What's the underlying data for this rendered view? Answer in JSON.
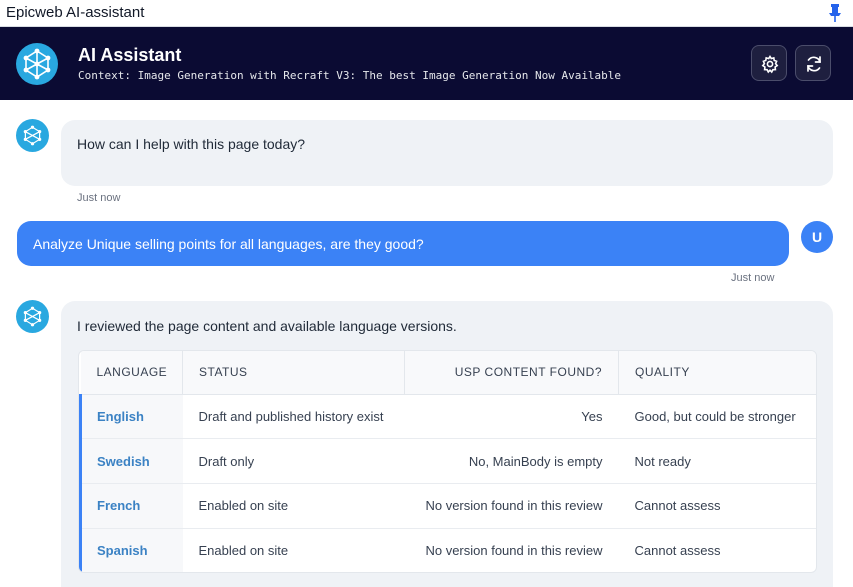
{
  "window": {
    "title": "Epicweb AI-assistant",
    "pin_icon": "pin-icon"
  },
  "header": {
    "title": "AI Assistant",
    "context": "Context: Image Generation with Recraft V3: The best Image Generation Now Available",
    "settings_icon": "gear-icon",
    "refresh_icon": "refresh-icon",
    "background": "#0b0b33"
  },
  "messages": {
    "greeting": {
      "text": "How can I help with this page today?",
      "time": "Just now"
    },
    "user": {
      "avatar": "U",
      "text": "Analyze Unique selling points for all languages, are they good?",
      "time": "Just now",
      "color": "#3b82f6"
    },
    "reply": {
      "intro": "I reviewed the page content and available language versions."
    }
  },
  "table": {
    "headers": [
      "LANGUAGE",
      "STATUS",
      "USP CONTENT FOUND?",
      "QUALITY"
    ],
    "rows": [
      [
        "English",
        "Draft and published history exist",
        "Yes",
        "Good, but could be stronger"
      ],
      [
        "Swedish",
        "Draft only",
        "No, MainBody is empty",
        "Not ready"
      ],
      [
        "French",
        "Enabled on site",
        "No version found in this review",
        "Cannot assess"
      ],
      [
        "Spanish",
        "Enabled on site",
        "No version found in this review",
        "Cannot assess"
      ]
    ]
  },
  "colors": {
    "accent": "#3b82f6",
    "ai_avatar": "#29a8e0",
    "bubble_ai": "#eff2f6"
  }
}
